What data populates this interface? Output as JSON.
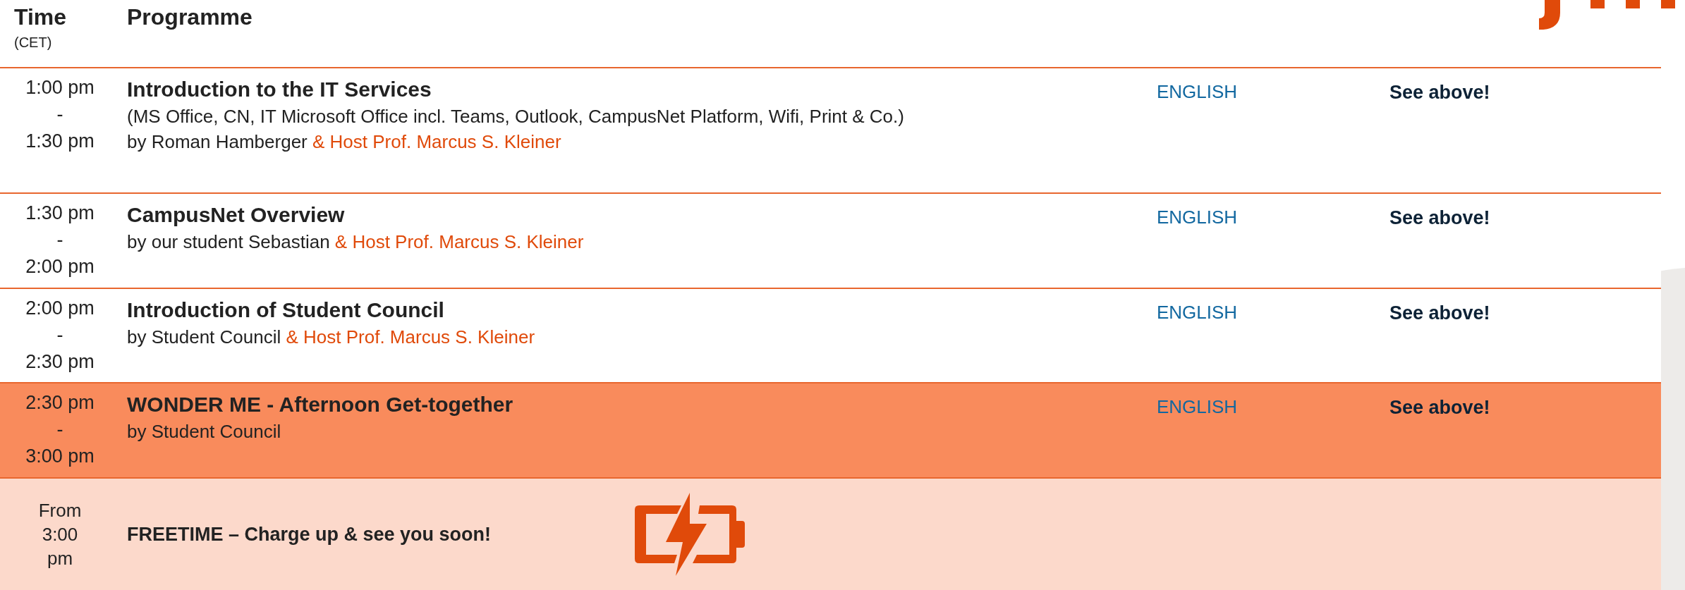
{
  "header": {
    "time": "Time",
    "time_zone": "(CET)",
    "programme": "Programme"
  },
  "rows": [
    {
      "kind": "session",
      "time_start": "1:00 pm",
      "separator": "-",
      "time_end": "1:30 pm",
      "title": "Introduction to the IT Services",
      "details": "(MS Office, CN, IT Microsoft Office incl. Teams, Outlook, CampusNet Platform, Wifi, Print & Co.)",
      "speaker": "by Roman Hamberger",
      "host": "& Host Prof. Marcus S. Kleiner",
      "language": "ENGLISH",
      "note": "See above!"
    },
    {
      "kind": "session",
      "time_start": "1:30 pm",
      "separator": "-",
      "time_end": "2:00 pm",
      "title": "CampusNet Overview",
      "speaker": "by our student Sebastian",
      "host": "& Host Prof. Marcus S. Kleiner",
      "language": "ENGLISH",
      "note": "See above!"
    },
    {
      "kind": "session",
      "time_start": "2:00 pm",
      "separator": "-",
      "time_end": "2:30 pm",
      "title": "Introduction of Student Council",
      "speaker": "by Student Council",
      "host": "& Host Prof. Marcus S. Kleiner",
      "language": "ENGLISH",
      "note": "See above!"
    },
    {
      "kind": "highlight",
      "time_start": "2:30 pm",
      "separator": "-",
      "time_end": "3:00 pm",
      "title": "WONDER ME - Afternoon Get-together",
      "speaker": "by Student Council",
      "language": "ENGLISH",
      "note": "See above!"
    },
    {
      "kind": "freetime",
      "time": "From 3:00 pm",
      "text": "FREETIME – Charge up & see you soon!"
    }
  ]
}
